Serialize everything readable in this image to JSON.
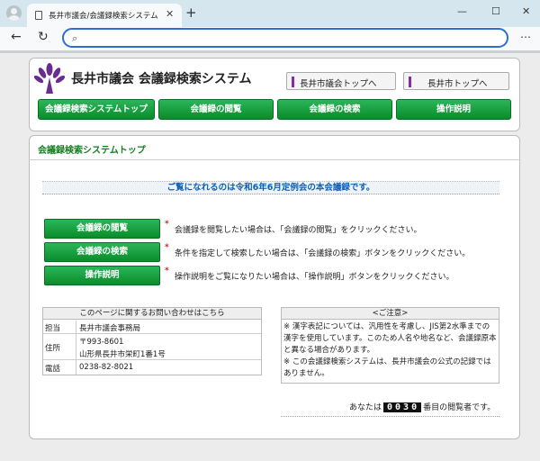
{
  "browser": {
    "tab_title": "長井市議会/会議録検索システム",
    "tab_close": "✕",
    "new_tab": "+",
    "minimize": "—",
    "maximize": "☐",
    "close": "✕",
    "back": "←",
    "reload": "↻",
    "menu": "⋯",
    "address_value": ""
  },
  "header": {
    "site_title": "長井市議会 会議録検索システム",
    "link_gikai": "長井市議会トップへ",
    "link_city": "長井市トップへ",
    "logo_color": "#6a2c91"
  },
  "nav": {
    "items": [
      {
        "label": "会議録検索システムトップ"
      },
      {
        "label": "会議録の閲覧"
      },
      {
        "label": "会議録の検索"
      },
      {
        "label": "操作説明"
      }
    ]
  },
  "main": {
    "title": "会議録検索システムトップ",
    "notice": "ご覧になれるのは令和6年6月定例会の本会議録です。",
    "actions": [
      {
        "label": "会議録の閲覧",
        "mark": "*",
        "desc": "会議録を閲覧したい場合は、「会議録の閲覧」をクリックください。"
      },
      {
        "label": "会議録の検索",
        "mark": "*",
        "desc": "条件を指定して検索したい場合は、「会議録の検索」ボタンをクリックください。"
      },
      {
        "label": "操作説明",
        "mark": "*",
        "desc": "操作説明をご覧になりたい場合は、「操作説明」ボタンをクリックください。"
      }
    ]
  },
  "contact": {
    "heading": "このページに関するお問い合わせはこちら",
    "rows": [
      {
        "key": "担当",
        "value": "長井市議会事務局"
      },
      {
        "key": "住所",
        "value": "〒993-8601",
        "value2": "山形県長井市栄町1番1号"
      },
      {
        "key": "電話",
        "value": "0238-82-8021"
      }
    ]
  },
  "caution": {
    "heading": "<ご注意>",
    "text1": "※ 漢字表記については、汎用性を考慮し、JIS第2水準までの漢字を使用しています。このため人名や地名など、会議録原本と異なる場合があります。",
    "text2": "※ この会議録検索システムは、長井市議会の公式の記録ではありません。"
  },
  "counter": {
    "prefix": "あなたは",
    "value": "0030",
    "suffix": "番目の閲覧者です。"
  },
  "colors": {
    "accent_green": "#0a8c2a",
    "notice_blue": "#0d5fb5",
    "address_border": "#2a6fd1"
  }
}
